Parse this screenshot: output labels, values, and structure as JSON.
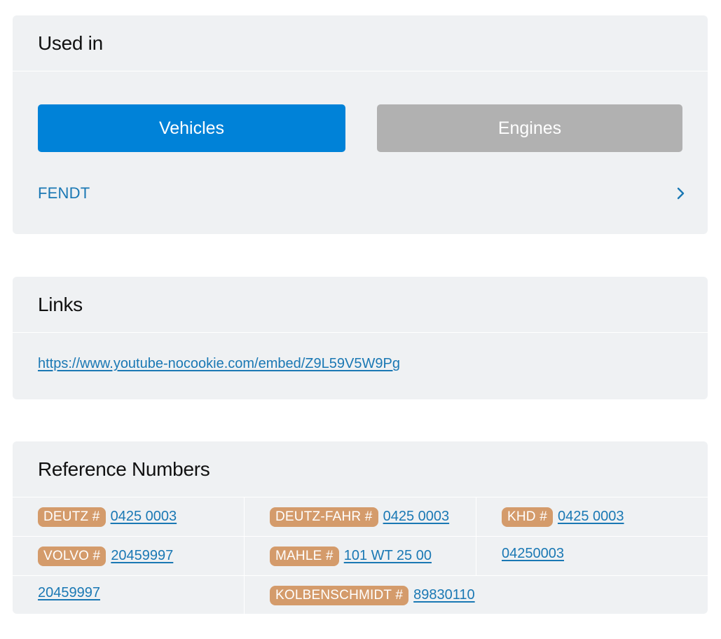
{
  "used_in": {
    "title": "Used in",
    "tabs": {
      "vehicles": "Vehicles",
      "engines": "Engines"
    },
    "colors": {
      "active": "#0082d8",
      "inactive": "#b1b1b1"
    },
    "items": [
      {
        "label": "FENDT",
        "icon": "chevron-right-icon"
      }
    ]
  },
  "links": {
    "title": "Links",
    "items": [
      {
        "url": "https://www.youtube-nocookie.com/embed/Z9L59V5W9Pg"
      }
    ]
  },
  "references": {
    "title": "Reference Numbers",
    "tag_color": "#d49b6b",
    "rows": [
      [
        {
          "tag": "DEUTZ #",
          "number": "0425 0003"
        },
        {
          "tag": "DEUTZ-FAHR #",
          "number": "0425 0003"
        },
        {
          "tag": "KHD #",
          "number": "0425 0003"
        }
      ],
      [
        {
          "tag": "VOLVO #",
          "number": "20459997"
        },
        {
          "tag": "MAHLE #",
          "number": "101 WT 25 00"
        },
        {
          "tag": "",
          "number": "04250003"
        }
      ],
      [
        {
          "tag": "",
          "number": "20459997"
        },
        {
          "tag": "KOLBENSCHMIDT #",
          "number": "89830110"
        }
      ]
    ]
  }
}
